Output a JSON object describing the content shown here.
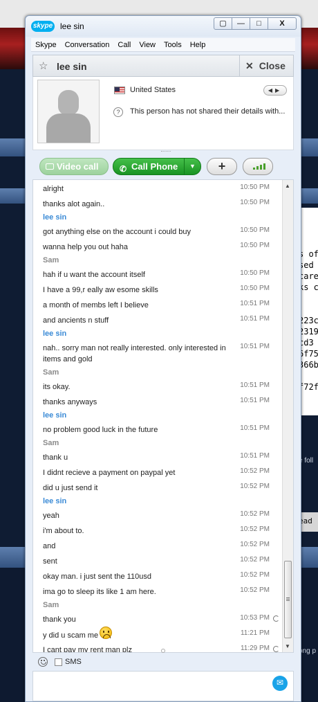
{
  "window": {
    "logo": "skype",
    "title": "lee sin",
    "buttons": [
      "▢",
      "—",
      "□",
      "X"
    ]
  },
  "menu": [
    "Skype",
    "Conversation",
    "Call",
    "View",
    "Tools",
    "Help"
  ],
  "header": {
    "contact_name": "lee sin",
    "close_label": "Close"
  },
  "profile": {
    "country": "United States",
    "details": "This person has not shared their details with..."
  },
  "callbar": {
    "video_label": "Video call",
    "phone_label": "Call Phone",
    "add_label": "+"
  },
  "messages": [
    {
      "type": "msg",
      "text": "alright",
      "time": "10:50 PM"
    },
    {
      "type": "msg",
      "text": "thanks alot again..",
      "time": "10:50 PM"
    },
    {
      "type": "sender",
      "name": "lee sin",
      "who": "lee"
    },
    {
      "type": "msg",
      "text": "got anything else on the account i could buy",
      "time": "10:50 PM"
    },
    {
      "type": "msg",
      "text": "wanna help you out haha",
      "time": "10:50 PM"
    },
    {
      "type": "sender",
      "name": "Sam",
      "who": "sam"
    },
    {
      "type": "msg",
      "text": "hah if u want the account itself",
      "time": "10:50 PM"
    },
    {
      "type": "msg",
      "text": "I have a 99,r eally aw esome skills",
      "time": "10:50 PM"
    },
    {
      "type": "msg",
      "text": "a month of membs left I believe",
      "time": "10:51 PM"
    },
    {
      "type": "msg",
      "text": "and ancients n stuff",
      "time": "10:51 PM"
    },
    {
      "type": "sender",
      "name": "lee sin",
      "who": "lee"
    },
    {
      "type": "msg2",
      "text": "nah.. sorry man not really interested. only interested in items and gold",
      "time": "10:51 PM"
    },
    {
      "type": "sender",
      "name": "Sam",
      "who": "sam"
    },
    {
      "type": "msg",
      "text": "its okay.",
      "time": "10:51 PM"
    },
    {
      "type": "msg",
      "text": "thanks anyways",
      "time": "10:51 PM"
    },
    {
      "type": "sender",
      "name": "lee sin",
      "who": "lee"
    },
    {
      "type": "msg",
      "text": "no problem good luck in the future",
      "time": "10:51 PM"
    },
    {
      "type": "sender",
      "name": "Sam",
      "who": "sam"
    },
    {
      "type": "msg",
      "text": "thank u",
      "time": "10:51 PM"
    },
    {
      "type": "msg",
      "text": "I didnt recieve a payment on paypal yet",
      "time": "10:52 PM"
    },
    {
      "type": "msg",
      "text": "did u just send it",
      "time": "10:52 PM"
    },
    {
      "type": "sender",
      "name": "lee sin",
      "who": "lee"
    },
    {
      "type": "msg",
      "text": "yeah",
      "time": "10:52 PM"
    },
    {
      "type": "msg",
      "text": "i'm about to.",
      "time": "10:52 PM"
    },
    {
      "type": "msg",
      "text": "and",
      "time": "10:52 PM"
    },
    {
      "type": "msg",
      "text": "sent",
      "time": "10:52 PM"
    },
    {
      "type": "msg",
      "text": "okay man. i just sent the 110usd",
      "time": "10:52 PM"
    },
    {
      "type": "msg",
      "text": "ima go to sleep its like 1 am here.",
      "time": "10:52 PM"
    },
    {
      "type": "sender",
      "name": "Sam",
      "who": "sam"
    },
    {
      "type": "msg",
      "text": "thank you",
      "time": "10:53 PM",
      "pending": true
    },
    {
      "type": "msg",
      "text": "y did u scam me",
      "time": "11:21 PM",
      "emoticon": "sad-emoticon"
    },
    {
      "type": "msg",
      "text": "I cant pay my rent man plz",
      "time": "11:29 PM",
      "pending": true
    }
  ],
  "input": {
    "sms_label": "SMS",
    "send_icon": "send-icon"
  },
  "background": {
    "fragments": [
      "s of",
      "sed",
      "care",
      "ks c",
      "223c",
      "2319",
      "cd3",
      "6f75",
      "366b",
      "f72f"
    ],
    "fragments_light": [
      "e foll",
      "ead",
      "ong p"
    ]
  }
}
